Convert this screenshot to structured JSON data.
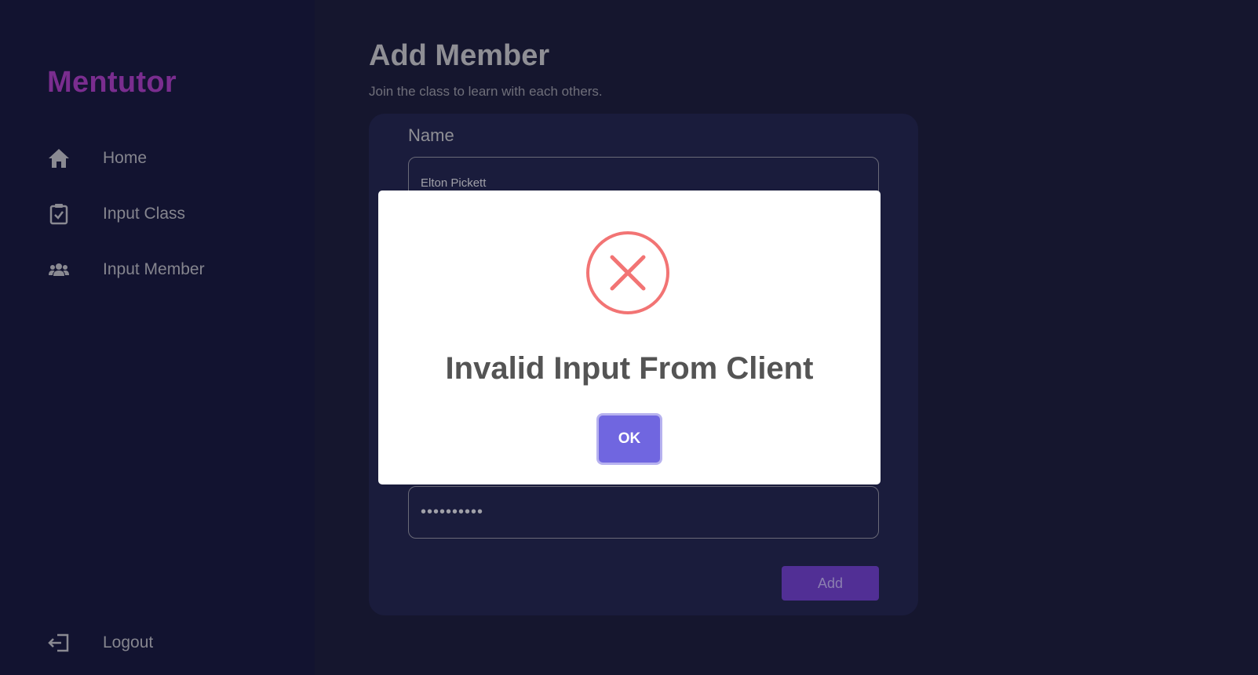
{
  "app": {
    "logo": "Mentutor"
  },
  "sidebar": {
    "items": [
      {
        "label": "Home",
        "icon": "home-icon"
      },
      {
        "label": "Input Class",
        "icon": "clipboard-check-icon"
      },
      {
        "label": "Input Member",
        "icon": "users-icon"
      }
    ],
    "logout": {
      "label": "Logout",
      "icon": "logout-icon"
    }
  },
  "main": {
    "title": "Add Member",
    "subtitle": "Join the class to learn with each others.",
    "form": {
      "name_label": "Name",
      "name_value": "Elton Pickett",
      "password_value": "••••••••••",
      "add_label": "Add"
    }
  },
  "modal": {
    "icon": "error-icon",
    "title": "Invalid Input From Client",
    "ok_label": "OK"
  },
  "colors": {
    "logo": "#7a2d8f",
    "accent": "#7066e0",
    "error": "#f27474",
    "add_button": "#512f95"
  }
}
